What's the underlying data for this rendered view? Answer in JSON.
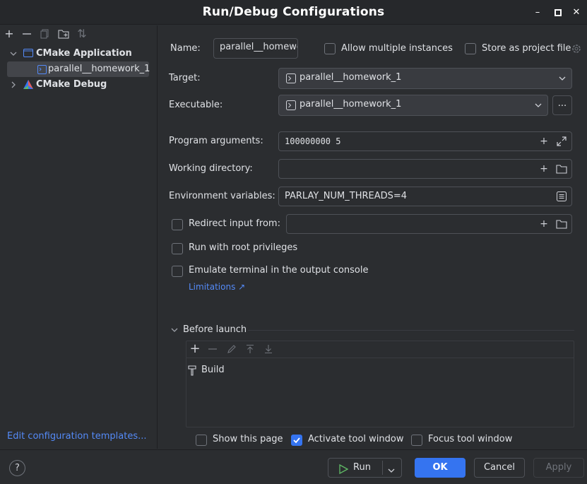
{
  "window": {
    "title": "Run/Debug Configurations",
    "minimize": "–",
    "maximize": "□",
    "close": "✕"
  },
  "sidebar": {
    "toolbar": {
      "add": "+",
      "remove": "—",
      "copy": "⧉",
      "new_folder": "▣",
      "sort": "⇅"
    },
    "tree": [
      {
        "label": "CMake Application",
        "expanded": true,
        "icon": "cmake-app-icon"
      },
      {
        "label": "parallel__homework_1",
        "selected": true,
        "icon": "cmake-target-icon"
      },
      {
        "label": "CMake Debug",
        "expanded": false,
        "icon": "cmake-debug-icon"
      }
    ],
    "edit_templates": "Edit configuration templates..."
  },
  "form": {
    "name_label": "Name:",
    "name_value": "parallel__homewo",
    "allow_multiple": "Allow multiple instances",
    "store_as_project": "Store as project file",
    "target_label": "Target:",
    "target_value": "parallel__homework_1",
    "executable_label": "Executable:",
    "executable_value": "parallel__homework_1",
    "browse": "...",
    "program_args_label": "Program arguments:",
    "program_args_value": "100000000 5",
    "working_dir_label": "Working directory:",
    "working_dir_value": "",
    "env_label": "Environment variables:",
    "env_value": "PARLAY_NUM_THREADS=4",
    "redirect_label": "Redirect input from:",
    "redirect_value": "",
    "root_priv": "Run with root privileges",
    "emulate_terminal": "Emulate terminal in the output console",
    "limitations": "Limitations ↗",
    "before_launch": "Before launch",
    "before_launch_item": "Build",
    "show_page": "Show this page",
    "activate_tool": "Activate tool window",
    "focus_tool": "Focus tool window"
  },
  "footer": {
    "help": "?",
    "run": "Run",
    "ok": "OK",
    "cancel": "Cancel",
    "apply": "Apply"
  },
  "colors": {
    "accent": "#3574f0",
    "link": "#548af7",
    "background": "#2b2d30"
  }
}
